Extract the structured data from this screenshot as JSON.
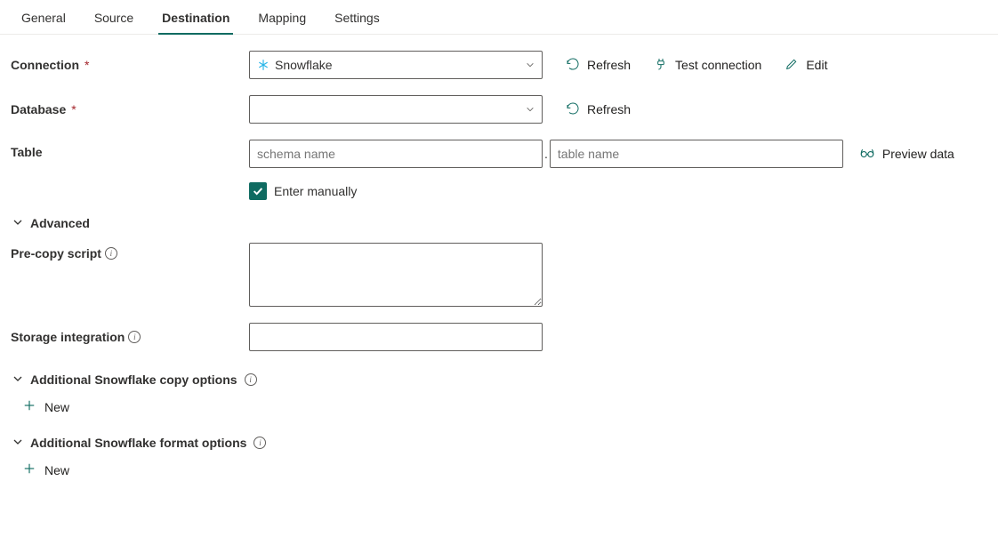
{
  "tabs": {
    "general": "General",
    "source": "Source",
    "destination": "Destination",
    "mapping": "Mapping",
    "settings": "Settings",
    "active": "destination"
  },
  "labels": {
    "connection": "Connection",
    "database": "Database",
    "table": "Table",
    "precopy": "Pre-copy script",
    "storage": "Storage integration"
  },
  "connection": {
    "value": "Snowflake",
    "refresh": "Refresh",
    "test": "Test connection",
    "edit": "Edit"
  },
  "database": {
    "value": "",
    "refresh": "Refresh"
  },
  "table": {
    "schema_placeholder": "schema name",
    "table_placeholder": "table name",
    "enter_manually": "Enter manually",
    "preview": "Preview data"
  },
  "sections": {
    "advanced": "Advanced",
    "copy_options": "Additional Snowflake copy options",
    "format_options": "Additional Snowflake format options"
  },
  "buttons": {
    "new": "New"
  }
}
